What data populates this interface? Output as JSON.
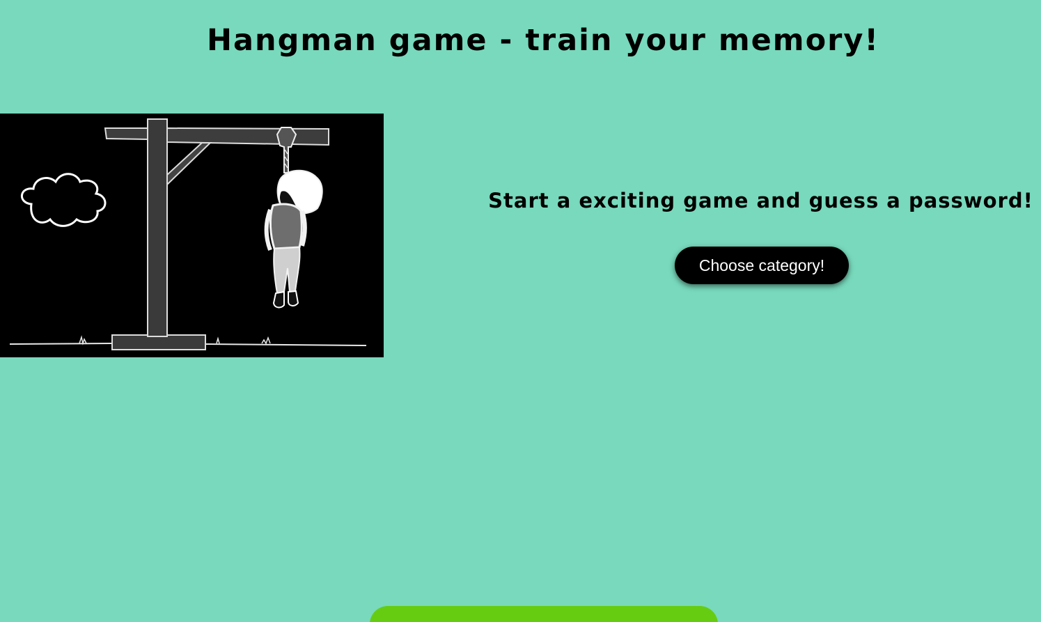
{
  "header": {
    "title": "Hangman game - train your memory!"
  },
  "intro": {
    "tagline": "Start a exciting game and guess a password!",
    "choose_button_label": "Choose category!"
  },
  "colors": {
    "background": "#78d9bc",
    "button": "#000000",
    "bottom_bar": "#66cc11"
  }
}
